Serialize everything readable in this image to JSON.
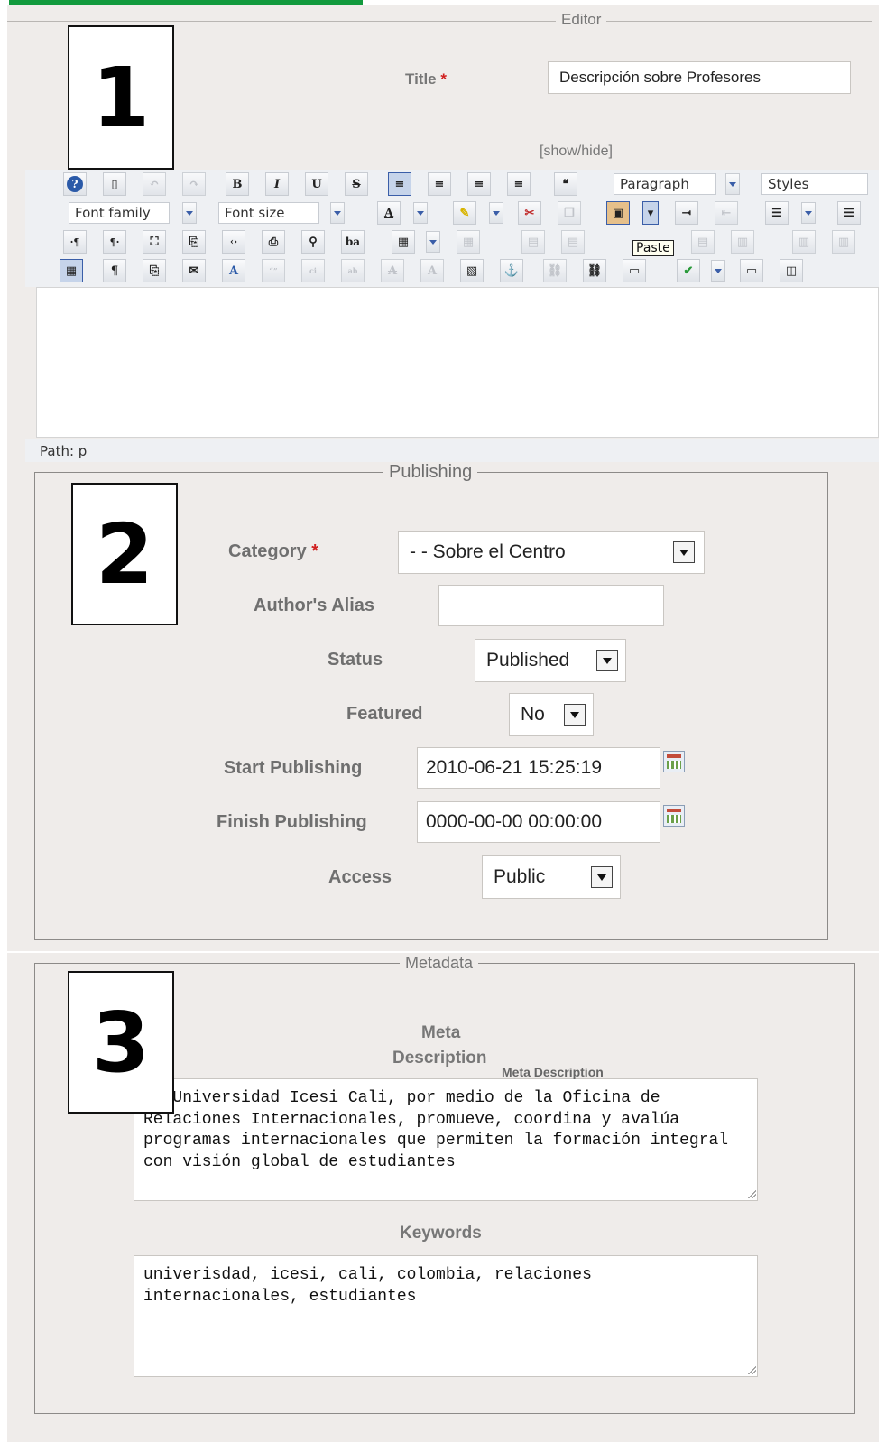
{
  "editor": {
    "legend": "Editor",
    "section_number": "1",
    "title_label": "Title",
    "required_mark": "*",
    "title_value": "Descripción sobre Profesores",
    "show_hide": "[show/hide]",
    "paragraph_select": "Paragraph",
    "styles_select": "Styles",
    "font_family_select": "Font family",
    "font_size_select": "Font size",
    "paste_tooltip": "Paste",
    "path_label": "Path:",
    "path_value": "p",
    "toolbar_icons_row1": [
      "help-icon",
      "new-document-icon",
      "undo-icon",
      "redo-icon",
      "bold-icon",
      "italic-icon",
      "underline-icon",
      "strikethrough-icon",
      "align-justify-icon",
      "align-center-icon",
      "align-left-icon",
      "align-right-icon",
      "blockquote-icon"
    ],
    "toolbar_icons_row2": [
      "font-color-icon",
      "highlight-icon",
      "cut-icon",
      "copy-icon",
      "paste-icon",
      "paste-options-icon",
      "indent-icon",
      "outdent-icon",
      "ordered-list-icon",
      "unordered-list-icon"
    ],
    "toolbar_icons_row3": [
      "ltr-icon",
      "rtl-icon",
      "fullscreen-icon",
      "template-icon",
      "code-icon",
      "print-icon",
      "search-replace-icon",
      "spellcheck-abc-icon",
      "insert-table-icon",
      "table-props-icon"
    ],
    "toolbar_icons_row4": [
      "visual-aid-icon",
      "show-blocks-icon",
      "insert-file-icon",
      "insert-email-icon",
      "char-map-icon",
      "quote-icon",
      "cite-icon",
      "abbr-icon",
      "remove-format-icon",
      "strike-format-icon",
      "insert-image-icon",
      "insert-anchor-icon",
      "insert-link-icon",
      "insert-media-icon",
      "spellcheck-icon",
      "hr-icon",
      "pagebreak-icon"
    ]
  },
  "publishing": {
    "legend": "Publishing",
    "section_number": "2",
    "category_label": "Category",
    "category_value": "- - Sobre el Centro",
    "authors_alias_label": "Author's Alias",
    "authors_alias_value": "",
    "status_label": "Status",
    "status_value": "Published",
    "featured_label": "Featured",
    "featured_value": "No",
    "start_publishing_label": "Start Publishing",
    "start_publishing_value": "2010-06-21 15:25:19",
    "finish_publishing_label": "Finish Publishing",
    "finish_publishing_value": "0000-00-00 00:00:00",
    "access_label": "Access",
    "access_value": "Public"
  },
  "metadata": {
    "legend": "Metadata",
    "section_number": "3",
    "meta_description_label_line1": "Meta",
    "meta_description_label_line2": "Description",
    "meta_description_tooltip": "Meta Description",
    "meta_description_value": "La Universidad Icesi Cali, por medio de la Oficina de Relaciones Internacionales, promueve, coordina y avalúa  programas internacionales que permiten la formación integral con visión global de estudiantes",
    "keywords_label": "Keywords",
    "keywords_value": "univerisdad, icesi, cali, colombia, relaciones internacionales, estudiantes"
  }
}
